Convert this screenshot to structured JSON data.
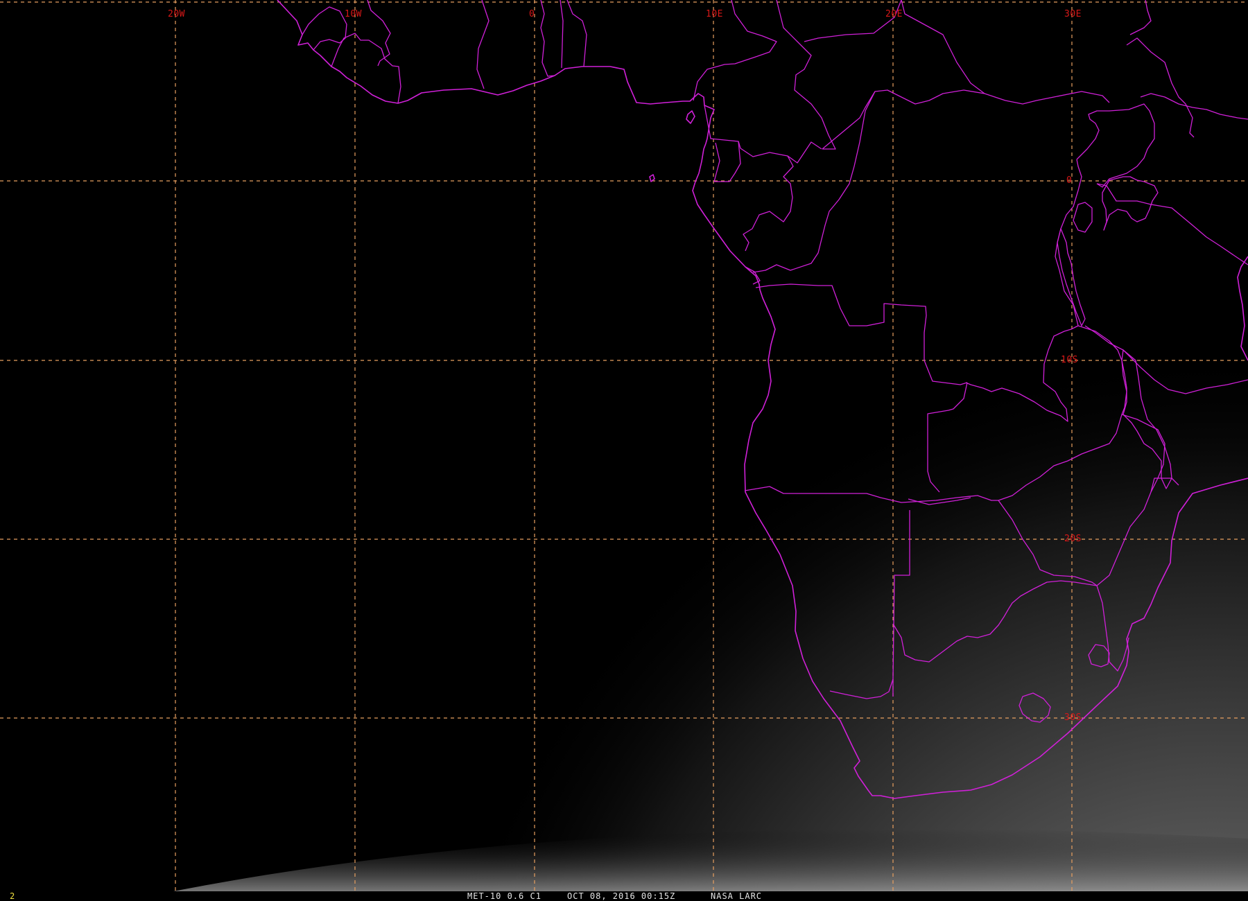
{
  "map": {
    "longitude_labels": [
      "20W",
      "10W",
      "0",
      "10E",
      "20E",
      "30E"
    ],
    "latitude_labels": [
      "0",
      "10S",
      "20S",
      "30S"
    ]
  },
  "status_bar": {
    "frame_number": "2",
    "satellite_channel": "MET-10 0.6 C1",
    "datetime": "OCT 08, 2016 00:15Z",
    "source": "NASA LARC"
  },
  "colors": {
    "background": "#000000",
    "coastline": "#d020d8",
    "grid": "#e8a060",
    "grid_label": "#d81818",
    "status_text": "#e6e6e6",
    "frame_number": "#f0e040"
  }
}
